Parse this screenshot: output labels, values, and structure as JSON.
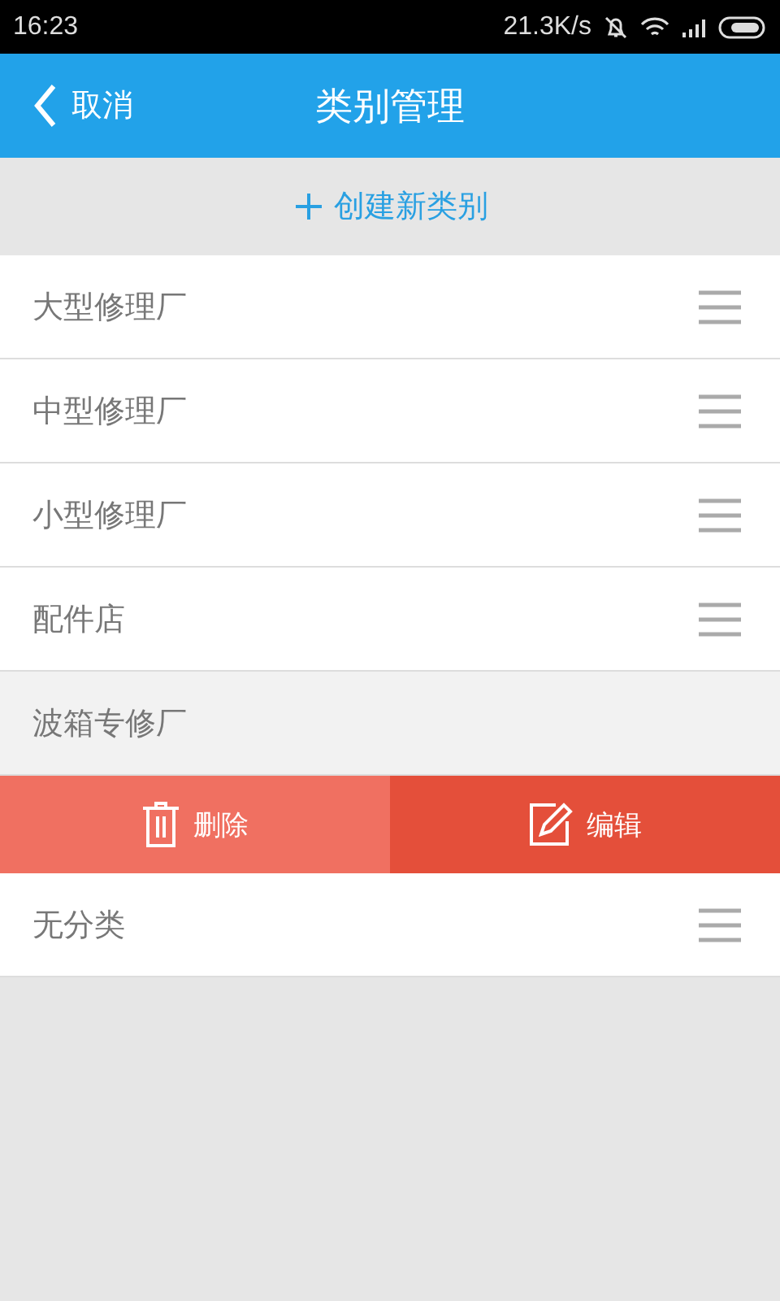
{
  "status_bar": {
    "time": "16:23",
    "speed": "21.3K/s"
  },
  "header": {
    "back": "取消",
    "title": "类别管理"
  },
  "create_button": {
    "label": "创建新类别"
  },
  "categories": [
    {
      "name": "大型修理厂",
      "expanded": false
    },
    {
      "name": "中型修理厂",
      "expanded": false
    },
    {
      "name": "小型修理厂",
      "expanded": false
    },
    {
      "name": "配件店",
      "expanded": false
    },
    {
      "name": "波箱专修厂",
      "expanded": true
    },
    {
      "name": "无分类",
      "expanded": false
    }
  ],
  "actions": {
    "delete": "删除",
    "edit": "编辑"
  }
}
